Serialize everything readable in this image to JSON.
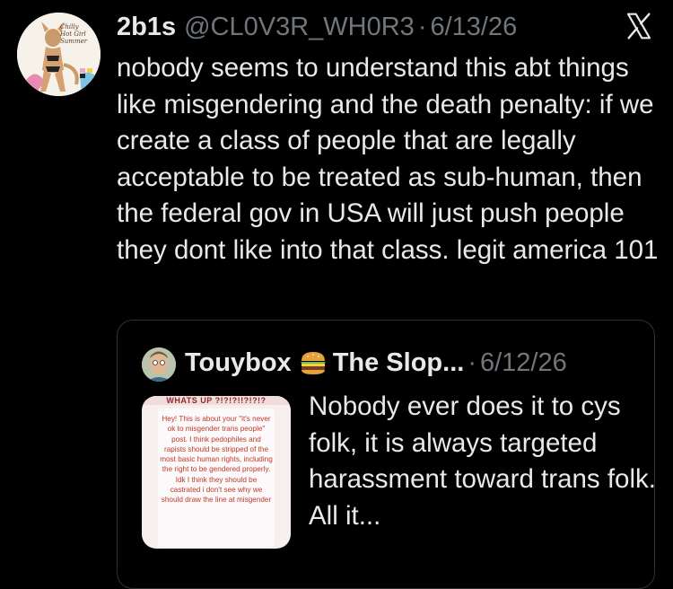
{
  "tweet": {
    "display_name": "2b1s",
    "handle": "@CL0V3R_WH0R3",
    "separator": "·",
    "date": "6/13/26",
    "text": "nobody seems to understand this abt things like misgendering and the death penalty: if we create a class of people that are legally acceptable to be treated as sub-human, then the federal gov in USA will just push people they dont like into that class. legit america 101",
    "avatar_lines": [
      "Chilly",
      "Hot Girl",
      "Summer"
    ]
  },
  "quoted_tweet": {
    "display_name": "Touybox",
    "title": "The Slop...",
    "separator": "·",
    "date": "6/12/26",
    "text": "Nobody ever does it to cys folk, it is always targeted harassment toward trans folk. All it...",
    "media": {
      "header": "WHATS UP ?!?!?!!?!?!?",
      "text": "Hey! This is about your \"it's never ok to misgender trans people\" post. I think pedophiles and rapists should be stripped of the most basic human rights, including the right to be gendered properly. Idk I think they should be castrated i don't see why we should draw the line at misgender"
    }
  },
  "icons": {
    "x_logo": "x-logo-icon",
    "burger": "hamburger-emoji-icon"
  },
  "colors": {
    "background": "#000000",
    "text_primary": "#e7e9ea",
    "text_secondary": "#71767b",
    "border": "#2f3336"
  }
}
